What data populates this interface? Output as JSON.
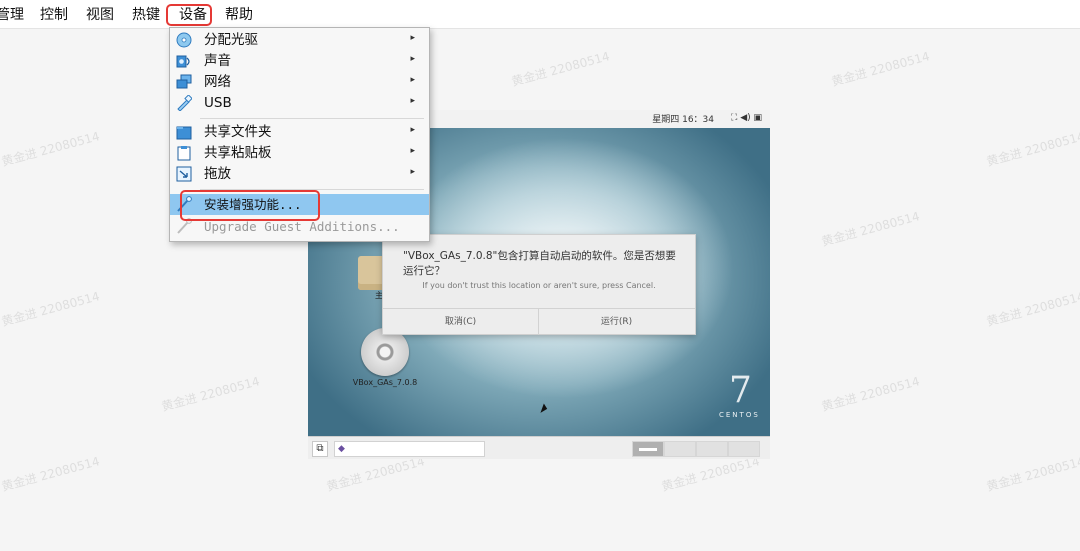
{
  "menubar": {
    "items": [
      "管理",
      "控制",
      "视图",
      "热键",
      "设备",
      "帮助"
    ]
  },
  "devices_menu": {
    "items": [
      {
        "label": "分配光驱",
        "icon": "optical-drive-icon",
        "submenu": true
      },
      {
        "label": "声音",
        "icon": "audio-icon",
        "submenu": true
      },
      {
        "label": "网络",
        "icon": "network-icon",
        "submenu": true
      },
      {
        "label": "USB",
        "icon": "usb-icon",
        "submenu": true
      },
      {
        "label": "共享文件夹",
        "icon": "shared-folder-icon",
        "submenu": true
      },
      {
        "label": "共享粘贴板",
        "icon": "clipboard-icon",
        "submenu": true
      },
      {
        "label": "拖放",
        "icon": "drag-drop-icon",
        "submenu": true
      },
      {
        "label": "安装增强功能...",
        "icon": "install-additions-icon",
        "submenu": false,
        "selected": true
      },
      {
        "label": "Upgrade Guest Additions...",
        "icon": "upgrade-additions-icon",
        "submenu": false,
        "disabled": true
      }
    ],
    "arrow": "▸"
  },
  "vm": {
    "clock": "星期四 16：34",
    "status_icons": "⛶  ◀)  ▣",
    "desktop_icons": [
      {
        "label": "主",
        "icon": "folder-icon"
      },
      {
        "label": "VBox_GAs_7.0.8",
        "icon": "disc-icon"
      }
    ],
    "brand_number": "7",
    "brand_word": "CENTOS",
    "taskbar": {
      "show_desktop": "⧉",
      "entry_icon": "◆"
    }
  },
  "dialog": {
    "title": "\"VBox_GAs_7.0.8\"包含打算自动启动的软件。您是否想要运行它？",
    "subtitle": "If you don't trust this location or aren't sure, press Cancel.",
    "cancel": "取消(C)",
    "run": "运行(R)"
  },
  "watermark": {
    "text": "黄金进 22080514"
  },
  "colors": {
    "highlight": "#e53935",
    "selected": "#8fc7f0"
  }
}
